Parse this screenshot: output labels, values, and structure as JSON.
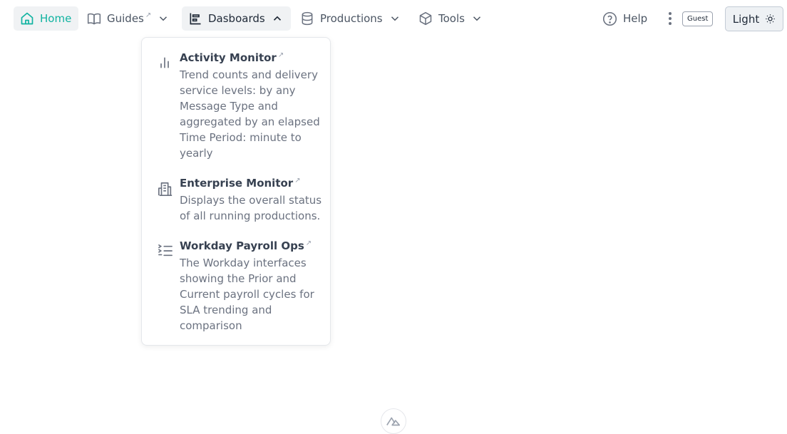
{
  "nav": {
    "home": {
      "label": "Home",
      "icon": "home-icon"
    },
    "guides": {
      "label": "Guides",
      "icon": "book-icon",
      "external": "↗"
    },
    "dashboards": {
      "label": "Dasboards",
      "icon": "chart-icon"
    },
    "productions": {
      "label": "Productions",
      "icon": "database-icon"
    },
    "tools": {
      "label": "Tools",
      "icon": "cube-icon"
    },
    "help": {
      "label": "Help",
      "icon": "help-circle-icon"
    },
    "guest_badge": "Guest",
    "theme_toggle": {
      "label": "Light",
      "icon": "sun-icon"
    }
  },
  "dropdown": {
    "items": [
      {
        "title": "Activity Monitor",
        "description": "Trend counts and delivery service levels: by any Message Type and aggregated by an elapsed Time Period: minute to yearly",
        "icon": "bar-chart-icon",
        "external": "↗"
      },
      {
        "title": "Enterprise Monitor",
        "description": "Displays the overall status of all running productions.",
        "icon": "building-icon",
        "external": "↗"
      },
      {
        "title": "Workday Payroll Ops",
        "description": "The Workday interfaces showing the Prior and Current payroll cycles for SLA trending and comparison",
        "icon": "list-icon",
        "external": "↗"
      }
    ]
  },
  "colors": {
    "accent": "#10b3a1",
    "text": "#4b5563",
    "active_bg": "#f0f2f4"
  }
}
